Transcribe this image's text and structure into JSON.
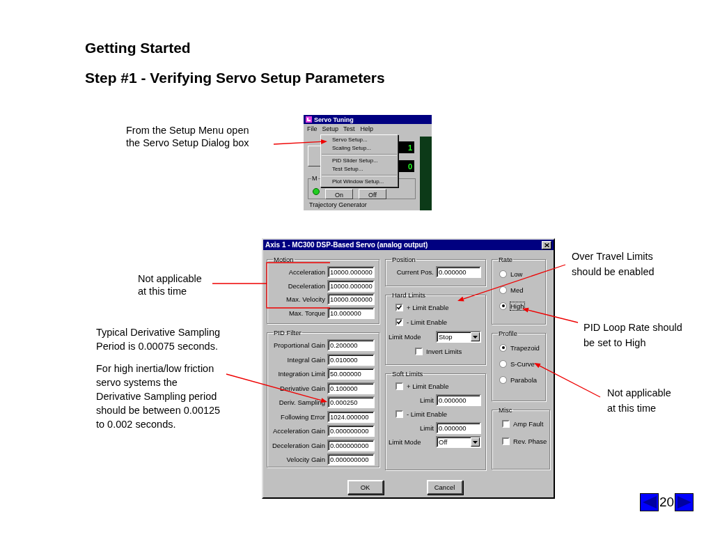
{
  "slide": {
    "title": "Getting Started",
    "subtitle": "Step #1 - Verifying Servo Setup Parameters",
    "page_number": "20"
  },
  "notes": [
    {
      "lines": [
        "From the Setup Menu open",
        "the Servo Setup Dialog box"
      ]
    },
    {
      "lines": [
        "Not applicable",
        "at this time"
      ]
    },
    {
      "lines": [
        "Typical Derivative Sampling",
        "Period is 0.00075 seconds."
      ]
    },
    {
      "lines": [
        "For high inertia/low friction",
        "servo systems the",
        "Derivative Sampling period",
        "should be between 0.00125",
        "to 0.002 seconds."
      ]
    },
    {
      "lines": [
        "Over Travel Limits",
        "should be enabled"
      ]
    },
    {
      "lines": [
        "PID Loop Rate should",
        "be set to High"
      ]
    },
    {
      "lines": [
        "Not applicable",
        "at this time"
      ]
    }
  ],
  "menu_window": {
    "title": "Servo Tuning",
    "menus": [
      {
        "label": "File",
        "selected": false
      },
      {
        "label": "Setup",
        "selected": true
      },
      {
        "label": "Test",
        "selected": false
      },
      {
        "label": "Help",
        "selected": false
      }
    ],
    "dropdown": [
      [
        {
          "label": "Servo Setup..."
        },
        {
          "label": "Scaling Setup..."
        }
      ],
      [
        {
          "label": "PID Slider Setup..."
        },
        {
          "label": "Test Setup..."
        }
      ],
      [
        {
          "label": "Plot Window Setup..."
        }
      ]
    ],
    "readouts": [
      "1",
      "0"
    ],
    "group_label": "M",
    "indicator_on": true,
    "buttons": [
      "On",
      "Off"
    ],
    "next_group_label": "Trajectory Generator"
  },
  "dialog": {
    "title": "Axis 1 - MC300 DSP-Based Servo (analog output)",
    "columns": [
      [
        {
          "label": "Motion",
          "items": [
            {
              "kind": "field",
              "label": "Acceleration",
              "value": "10000.000000"
            },
            {
              "kind": "field",
              "label": "Deceleration",
              "value": "10000.000000"
            },
            {
              "kind": "field",
              "label": "Max. Velocity",
              "value": "10000.000000"
            },
            {
              "kind": "field",
              "label": "Max. Torque",
              "value": "10.000000"
            }
          ]
        },
        {
          "label": "PID Filter",
          "items": [
            {
              "kind": "field",
              "label": "Proportional Gain",
              "value": "0.200000"
            },
            {
              "kind": "field",
              "label": "Integral Gain",
              "value": "0.010000"
            },
            {
              "kind": "field",
              "label": "Integration Limit",
              "value": "50.000000"
            },
            {
              "kind": "field",
              "label": "Derivative Gain",
              "value": "0.100000"
            },
            {
              "kind": "field",
              "label": "Deriv. Sampling",
              "value": "0.000250"
            },
            {
              "kind": "field",
              "label": "Following Error",
              "value": "1024.000000"
            },
            {
              "kind": "field",
              "label": "Acceleration Gain",
              "value": "0.000000000"
            },
            {
              "kind": "field",
              "label": "Deceleration Gain",
              "value": "0.000000000"
            },
            {
              "kind": "field",
              "label": "Velocity Gain",
              "value": "0.000000000"
            }
          ]
        }
      ],
      [
        {
          "label": "Position",
          "items": [
            {
              "kind": "field",
              "label": "Current Pos.",
              "value": "0.000000"
            }
          ]
        },
        {
          "label": "Hard Limits",
          "items": [
            {
              "kind": "checkbox",
              "label": "+ Limit Enable",
              "checked": true
            },
            {
              "kind": "checkbox",
              "label": "- Limit Enable",
              "checked": true
            },
            {
              "kind": "select",
              "label": "Limit Mode",
              "value": "Stop"
            },
            {
              "kind": "checkbox",
              "label": "Invert Limits",
              "checked": false
            }
          ]
        },
        {
          "label": "Soft Limits",
          "items": [
            {
              "kind": "checkbox",
              "label": "+ Limit Enable",
              "checked": false
            },
            {
              "kind": "field",
              "label": "Limit",
              "value": "0.000000"
            },
            {
              "kind": "checkbox",
              "label": "- Limit Enable",
              "checked": false
            },
            {
              "kind": "field",
              "label": "Limit",
              "value": "0.000000"
            },
            {
              "kind": "select",
              "label": "Limit Mode",
              "value": "Off"
            }
          ]
        }
      ],
      [
        {
          "label": "Rate",
          "items": [
            {
              "kind": "radio",
              "label": "Low",
              "selected": false,
              "focused": false
            },
            {
              "kind": "radio",
              "label": "Med",
              "selected": false,
              "focused": false
            },
            {
              "kind": "radio",
              "label": "High",
              "selected": true,
              "focused": true
            }
          ]
        },
        {
          "label": "Profile",
          "items": [
            {
              "kind": "radio",
              "label": "Trapezoid",
              "selected": true
            },
            {
              "kind": "radio",
              "label": "S-Curve",
              "selected": false
            },
            {
              "kind": "radio",
              "label": "Parabola",
              "selected": false
            }
          ]
        },
        {
          "label": "Misc",
          "items": [
            {
              "kind": "checkbox",
              "label": "Amp Fault",
              "checked": false
            },
            {
              "kind": "checkbox",
              "label": "Rev. Phase",
              "checked": false
            }
          ]
        }
      ]
    ],
    "buttons": [
      "OK",
      "Cancel"
    ]
  }
}
